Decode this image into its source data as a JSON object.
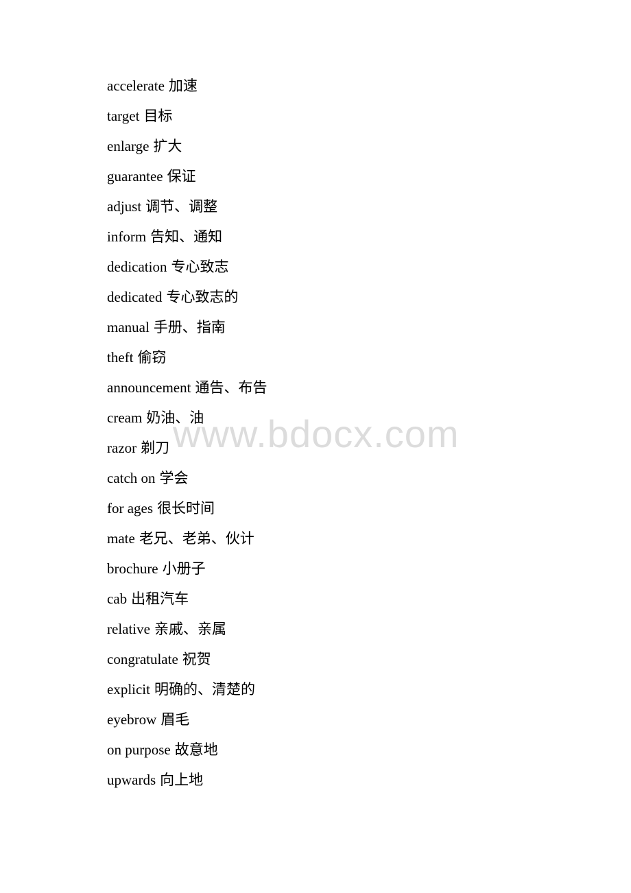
{
  "document": {
    "entries": [
      {
        "term": "accelerate",
        "meaning": "加速"
      },
      {
        "term": "target",
        "meaning": "目标"
      },
      {
        "term": "enlarge",
        "meaning": "扩大"
      },
      {
        "term": "guarantee",
        "meaning": "保证"
      },
      {
        "term": "adjust",
        "meaning": "调节、调整"
      },
      {
        "term": "inform",
        "meaning": "告知、通知"
      },
      {
        "term": "dedication",
        "meaning": "专心致志"
      },
      {
        "term": "dedicated",
        "meaning": "专心致志的"
      },
      {
        "term": "manual",
        "meaning": "手册、指南"
      },
      {
        "term": "theft",
        "meaning": "偷窃"
      },
      {
        "term": "announcement",
        "meaning": "通告、布告"
      },
      {
        "term": "cream",
        "meaning": "奶油、油"
      },
      {
        "term": "razor",
        "meaning": "剃刀"
      },
      {
        "term": "catch on",
        "meaning": "学会"
      },
      {
        "term": "for ages",
        "meaning": "很长时间"
      },
      {
        "term": "mate",
        "meaning": "老兄、老弟、伙计"
      },
      {
        "term": "brochure",
        "meaning": "小册子"
      },
      {
        "term": "cab",
        "meaning": "出租汽车"
      },
      {
        "term": "relative",
        "meaning": "亲戚、亲属"
      },
      {
        "term": "congratulate",
        "meaning": "祝贺"
      },
      {
        "term": "explicit",
        "meaning": "明确的、清楚的"
      },
      {
        "term": "eyebrow",
        "meaning": "眉毛"
      },
      {
        "term": "on purpose",
        "meaning": "故意地"
      },
      {
        "term": "upwards",
        "meaning": "向上地"
      }
    ]
  },
  "watermark": {
    "text": "www.bdocx.com"
  }
}
